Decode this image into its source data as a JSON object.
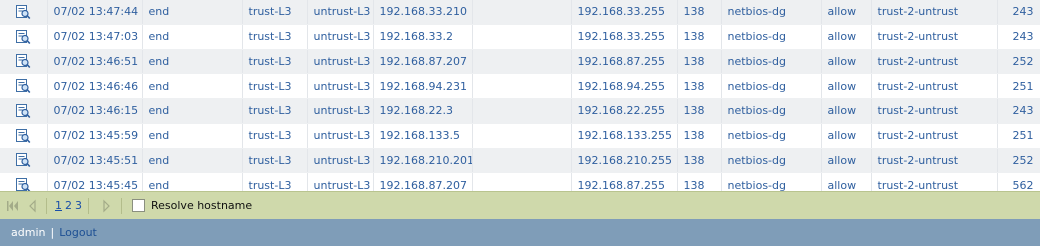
{
  "table": {
    "rows": [
      {
        "time": "07/02 13:47:44",
        "type": "end",
        "from_zone": "trust-L3",
        "to_zone": "untrust-L3",
        "source": "192.168.33.210",
        "user": "",
        "destination": "192.168.33.255",
        "port": "138",
        "application": "netbios-dg",
        "action": "allow",
        "rule": "trust-2-untrust",
        "bytes": "243"
      },
      {
        "time": "07/02 13:47:03",
        "type": "end",
        "from_zone": "trust-L3",
        "to_zone": "untrust-L3",
        "source": "192.168.33.2",
        "user": "",
        "destination": "192.168.33.255",
        "port": "138",
        "application": "netbios-dg",
        "action": "allow",
        "rule": "trust-2-untrust",
        "bytes": "243"
      },
      {
        "time": "07/02 13:46:51",
        "type": "end",
        "from_zone": "trust-L3",
        "to_zone": "untrust-L3",
        "source": "192.168.87.207",
        "user": "",
        "destination": "192.168.87.255",
        "port": "138",
        "application": "netbios-dg",
        "action": "allow",
        "rule": "trust-2-untrust",
        "bytes": "252"
      },
      {
        "time": "07/02 13:46:46",
        "type": "end",
        "from_zone": "trust-L3",
        "to_zone": "untrust-L3",
        "source": "192.168.94.231",
        "user": "",
        "destination": "192.168.94.255",
        "port": "138",
        "application": "netbios-dg",
        "action": "allow",
        "rule": "trust-2-untrust",
        "bytes": "251"
      },
      {
        "time": "07/02 13:46:15",
        "type": "end",
        "from_zone": "trust-L3",
        "to_zone": "untrust-L3",
        "source": "192.168.22.3",
        "user": "",
        "destination": "192.168.22.255",
        "port": "138",
        "application": "netbios-dg",
        "action": "allow",
        "rule": "trust-2-untrust",
        "bytes": "243"
      },
      {
        "time": "07/02 13:45:59",
        "type": "end",
        "from_zone": "trust-L3",
        "to_zone": "untrust-L3",
        "source": "192.168.133.5",
        "user": "",
        "destination": "192.168.133.255",
        "port": "138",
        "application": "netbios-dg",
        "action": "allow",
        "rule": "trust-2-untrust",
        "bytes": "251"
      },
      {
        "time": "07/02 13:45:51",
        "type": "end",
        "from_zone": "trust-L3",
        "to_zone": "untrust-L3",
        "source": "192.168.210.201",
        "user": "",
        "destination": "192.168.210.255",
        "port": "138",
        "application": "netbios-dg",
        "action": "allow",
        "rule": "trust-2-untrust",
        "bytes": "252"
      },
      {
        "time": "07/02 13:45:45",
        "type": "end",
        "from_zone": "trust-L3",
        "to_zone": "untrust-L3",
        "source": "192.168.87.207",
        "user": "",
        "destination": "192.168.87.255",
        "port": "138",
        "application": "netbios-dg",
        "action": "allow",
        "rule": "trust-2-untrust",
        "bytes": "562"
      }
    ]
  },
  "pager": {
    "pages": [
      "1",
      "2",
      "3"
    ],
    "current_page": "1",
    "resolve_hostname_label": "Resolve hostname",
    "resolve_hostname_checked": false
  },
  "footer": {
    "user": "admin",
    "separator": "|",
    "logout_label": "Logout"
  },
  "icons": {
    "row_detail": "log-detail-magnifier-icon",
    "first_page": "first-page-icon",
    "prev_page": "prev-page-icon",
    "next_page": "next-page-icon"
  },
  "colors": {
    "link_text": "#2f5f9f",
    "row_alt": "#eef0f2",
    "pager_bg": "#cfd9ab",
    "footer_bg": "#7f9db8",
    "logout_link": "#1d4f93"
  }
}
